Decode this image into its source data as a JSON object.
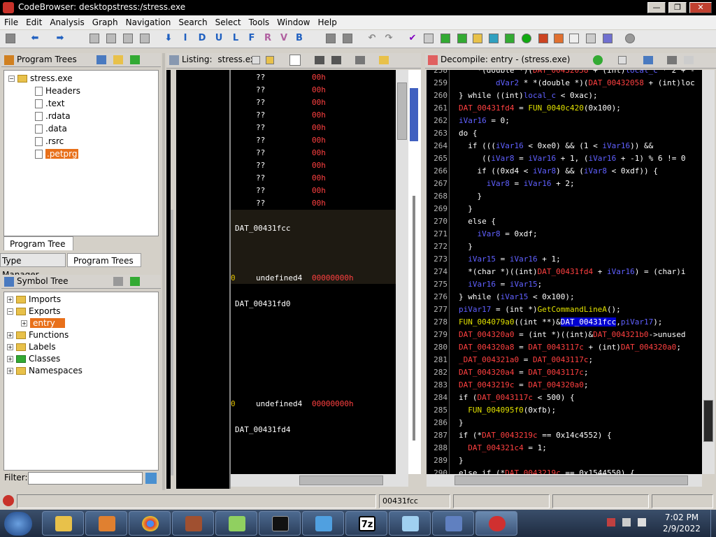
{
  "window": {
    "title": "CodeBrowser: desktopstress:/stress.exe",
    "minimize": "—",
    "maximize": "❐",
    "close": "✕"
  },
  "menu": [
    "File",
    "Edit",
    "Analysis",
    "Graph",
    "Navigation",
    "Search",
    "Select",
    "Tools",
    "Window",
    "Help"
  ],
  "toolbar": {
    "letters": [
      "I",
      "D",
      "U",
      "L",
      "F",
      "R",
      "V",
      "B"
    ],
    "arrows": {
      "back": "⬅",
      "forward": "➡",
      "down": "⬇",
      "undo": "↶",
      "redo": "↷",
      "check": "✔"
    }
  },
  "program_trees": {
    "title": "Program Trees",
    "root": "stress.exe",
    "items": [
      "Headers",
      ".text",
      ".rdata",
      ".data",
      ".rsrc",
      ".petprg"
    ],
    "tab": "Program Tree",
    "bottom_tabs": [
      "Type Manager",
      "Program Trees"
    ]
  },
  "symbol_tree": {
    "title": "Symbol Tree",
    "items": [
      "Imports",
      "Exports",
      "entry",
      "Functions",
      "Labels",
      "Classes",
      "Namespaces"
    ],
    "filter_label": "Filter:"
  },
  "listing": {
    "title": "Listing:",
    "file": "stress.exe",
    "rows": [
      {
        "a": "??",
        "b": "00h"
      },
      {
        "a": "??",
        "b": "00h"
      },
      {
        "a": "??",
        "b": "00h"
      },
      {
        "a": "??",
        "b": "00h"
      },
      {
        "a": "??",
        "b": "00h"
      },
      {
        "a": "??",
        "b": "00h"
      },
      {
        "a": "??",
        "b": "00h"
      },
      {
        "a": "??",
        "b": "00h"
      },
      {
        "a": "??",
        "b": "00h"
      },
      {
        "a": "??",
        "b": "00h"
      },
      {
        "a": "??",
        "b": "00h"
      }
    ],
    "label1": "DAT_00431fcc",
    "undef1_type": "undefined4",
    "undef1_val": "00000000h",
    "label2": "DAT_00431fd0",
    "undef2_type": "undefined4",
    "undef2_val": "00000000h",
    "label3": "DAT_00431fd4"
  },
  "decompile": {
    "title": "Decompile: entry -  (stress.exe)",
    "lines": [
      {
        "n": "258",
        "t": "    *(double *)(DAT_00432058 + (int)local_c * 2 + -"
      },
      {
        "n": "259",
        "t": "        dVar2 * *(double *)(DAT_00432058 + (int)loc"
      },
      {
        "n": "260",
        "t": "} while ((int)local_c < 0xac);"
      },
      {
        "n": "261",
        "t": "DAT_00431fd4 = FUN_0040c420(0x100);"
      },
      {
        "n": "262",
        "t": "iVar16 = 0;"
      },
      {
        "n": "263",
        "t": "do {"
      },
      {
        "n": "264",
        "t": "  if (((iVar16 < 0xe0) && (1 < iVar16)) &&"
      },
      {
        "n": "265",
        "t": "     ((iVar8 = iVar16 + 1, (iVar16 + -1) % 6 != 0"
      },
      {
        "n": "266",
        "t": "    if ((0xd4 < iVar8) && (iVar8 < 0xdf)) {"
      },
      {
        "n": "267",
        "t": "      iVar8 = iVar16 + 2;"
      },
      {
        "n": "268",
        "t": "    }"
      },
      {
        "n": "269",
        "t": "  }"
      },
      {
        "n": "270",
        "t": "  else {"
      },
      {
        "n": "271",
        "t": "    iVar8 = 0xdf;"
      },
      {
        "n": "272",
        "t": "  }"
      },
      {
        "n": "273",
        "t": "  iVar15 = iVar16 + 1;"
      },
      {
        "n": "274",
        "t": "  *(char *)((int)DAT_00431fd4 + iVar16) = (char)i"
      },
      {
        "n": "275",
        "t": "  iVar16 = iVar15;"
      },
      {
        "n": "276",
        "t": "} while (iVar15 < 0x100);"
      },
      {
        "n": "277",
        "t": "piVar17 = (int *)GetCommandLineA();"
      },
      {
        "n": "278",
        "t": "FUN_004079a0((int **)&DAT_00431fcc,piVar17);"
      },
      {
        "n": "279",
        "t": "DAT_004320a0 = (int *)((int)&DAT_004321b0->unused"
      },
      {
        "n": "280",
        "t": "DAT_004320a8 = DAT_0043117c + (int)DAT_004320a0;"
      },
      {
        "n": "281",
        "t": "_DAT_004321a0 = DAT_0043117c;"
      },
      {
        "n": "282",
        "t": "DAT_004320a4 = DAT_0043117c;"
      },
      {
        "n": "283",
        "t": "DAT_0043219c = DAT_004320a0;"
      },
      {
        "n": "284",
        "t": "if (DAT_0043117c < 500) {"
      },
      {
        "n": "285",
        "t": "  FUN_004095f0(0xfb);"
      },
      {
        "n": "286",
        "t": "}"
      },
      {
        "n": "287",
        "t": "if (*DAT_0043219c == 0x14c4552) {"
      },
      {
        "n": "288",
        "t": "  DAT_004321c4 = 1;"
      },
      {
        "n": "289",
        "t": "}"
      },
      {
        "n": "290",
        "t": "else if (*DAT_0043219c == 0x1544550) {"
      }
    ]
  },
  "status": {
    "address": "00431fcc"
  },
  "tray": {
    "time": "7:02 PM",
    "date": "2/9/2022"
  },
  "taskbar_apps": [
    "explorer",
    "media-player",
    "chrome",
    "winrar",
    "notepad-plus",
    "cmd",
    "network",
    "7zip",
    "notepad",
    "control-panel",
    "ghidra"
  ]
}
